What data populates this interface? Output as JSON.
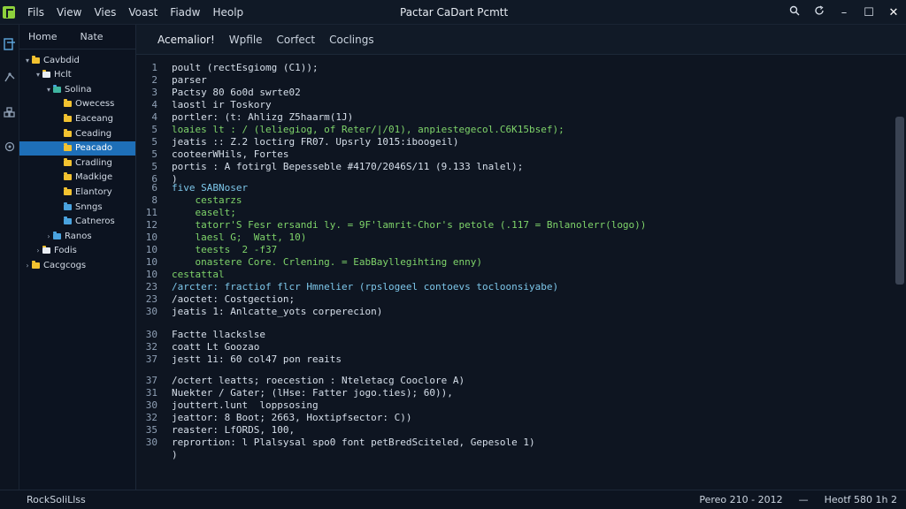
{
  "titlebar": {
    "menu": [
      "Fils",
      "View",
      "Vies",
      "Voast",
      "Fiadw",
      "Heolp"
    ],
    "title": "Pactar CaDart Pcmtt"
  },
  "explorer": {
    "tabs": [
      "Home",
      "Nate"
    ],
    "tree": [
      {
        "label": "Cavbdid",
        "depth": 0,
        "arrow": "▾",
        "color": "yellow"
      },
      {
        "label": "Hclt",
        "depth": 1,
        "arrow": "▾",
        "color": "white"
      },
      {
        "label": "Solina",
        "depth": 2,
        "arrow": "▾",
        "color": "green"
      },
      {
        "label": "Owecess",
        "depth": 3,
        "arrow": "",
        "color": "yellow"
      },
      {
        "label": "Eaceang",
        "depth": 3,
        "arrow": "",
        "color": "yellow"
      },
      {
        "label": "Ceading",
        "depth": 3,
        "arrow": "",
        "color": "yellow"
      },
      {
        "label": "Peacado",
        "depth": 3,
        "arrow": "",
        "color": "yellow",
        "selected": true
      },
      {
        "label": "Cradling",
        "depth": 3,
        "arrow": "",
        "color": "yellow"
      },
      {
        "label": "Madkige",
        "depth": 3,
        "arrow": "",
        "color": "yellow"
      },
      {
        "label": "Elantory",
        "depth": 3,
        "arrow": "",
        "color": "yellow"
      },
      {
        "label": "Snngs",
        "depth": 3,
        "arrow": "",
        "color": "blue"
      },
      {
        "label": "Catneros",
        "depth": 3,
        "arrow": "",
        "color": "blue"
      },
      {
        "label": "Ranos",
        "depth": 2,
        "arrow": "›",
        "color": "blue"
      },
      {
        "label": "Fodis",
        "depth": 1,
        "arrow": "›",
        "color": "white"
      },
      {
        "label": "Cacgcogs",
        "depth": 0,
        "arrow": "›",
        "color": "yellow"
      }
    ]
  },
  "editor": {
    "tabs": [
      "Acemalior!",
      "Wpfile",
      "Corfect",
      "Coclings"
    ],
    "lines": [
      {
        "n": "1",
        "text": "poult (rectEsgiomg (C1));",
        "c": "white"
      },
      {
        "n": "2",
        "text": "parser",
        "c": "white"
      },
      {
        "n": "3",
        "text": "Pactsy 80 6o0d swrte02",
        "c": "white"
      },
      {
        "n": "4",
        "text": "laostl ir Toskory",
        "c": "white"
      },
      {
        "n": "4",
        "text": "portler: (t: Ahlizg Z5haarm(1J)",
        "c": "white"
      },
      {
        "n": "5",
        "text": "loaies lt : / (leliegiog, of Reter/|/01), anpiestegecol.C6K15bsef);",
        "c": "green"
      },
      {
        "n": "5",
        "text": "jeatis :: Z.2 loctirg FR07. Upsrly 1015:iboogeil)",
        "c": "white"
      },
      {
        "n": "5",
        "text": "cooteerWHils, Fortes",
        "c": "white"
      },
      {
        "n": "5",
        "text": "portis : A fotirgl Bepesseble #4170/2046S/11 (9.133 lnalel);",
        "c": "white"
      },
      {
        "n": "6",
        "text": ")",
        "c": "white"
      },
      {
        "n": "6",
        "text": "five SABNoser",
        "c": "cyan"
      },
      {
        "n": "8",
        "text": "    cestarzs",
        "c": "green"
      },
      {
        "n": "11",
        "text": "    easelt;",
        "c": "green"
      },
      {
        "n": "12",
        "text": "    tatorr'S Fesr ersandi ly. = 9F'lamrit-Chor's petole (.117 = Bnlanolerr(logo))",
        "c": "green"
      },
      {
        "n": "10",
        "text": "    laesl G;  Watt, 10)",
        "c": "green"
      },
      {
        "n": "10",
        "text": "    teests  2 -f37",
        "c": "green"
      },
      {
        "n": "10",
        "text": "    onastere Core. Crlening. = EabBayllegihting enny)",
        "c": "green"
      },
      {
        "n": "10",
        "text": "cestattal",
        "c": "green"
      },
      {
        "n": "23",
        "text": "/arcter: fractiof flcr Hmnelier (rpslogeel contoevs tocloonsiyabe)",
        "c": "cyan"
      },
      {
        "n": "23",
        "text": "/aoctet: Costgection;",
        "c": "white"
      },
      {
        "n": "30",
        "text": "jeatis 1: Anlcatte_yots corperecion)",
        "c": "white"
      },
      {
        "n": "30",
        "text": "Factte llackslse",
        "c": "white"
      },
      {
        "n": "32",
        "text": "coatt Lt Goozao",
        "c": "white"
      },
      {
        "n": "37",
        "text": "jestt 1i: 60 col47 pon reaits",
        "c": "white"
      },
      {
        "n": "37",
        "text": "/octert leatts; roecestion : Nteletacg Cooclore A)",
        "c": "white"
      },
      {
        "n": "31",
        "text": "Nuekter / Gater; (lHse: Fatter jogo.ties); 60)),",
        "c": "white"
      },
      {
        "n": "30",
        "text": "jouttert.lunt  loppsosing",
        "c": "white"
      },
      {
        "n": "32",
        "text": "jeattor: 8 Boot; 2663, Hoxtipfsector: C))",
        "c": "white"
      },
      {
        "n": "35",
        "text": "reaster: LfORDS, 100,",
        "c": "white"
      },
      {
        "n": "30",
        "text": "reprortion: l Plalsysal spo0 font petBredSciteled, Gepesole 1)",
        "c": "white"
      },
      {
        "n": "",
        "text": ")",
        "c": "white"
      }
    ]
  },
  "status": {
    "left": "RockSoliLlss",
    "right": [
      "Pereo 210 - 2012",
      "—",
      "Heotf 580 1h 2"
    ]
  }
}
